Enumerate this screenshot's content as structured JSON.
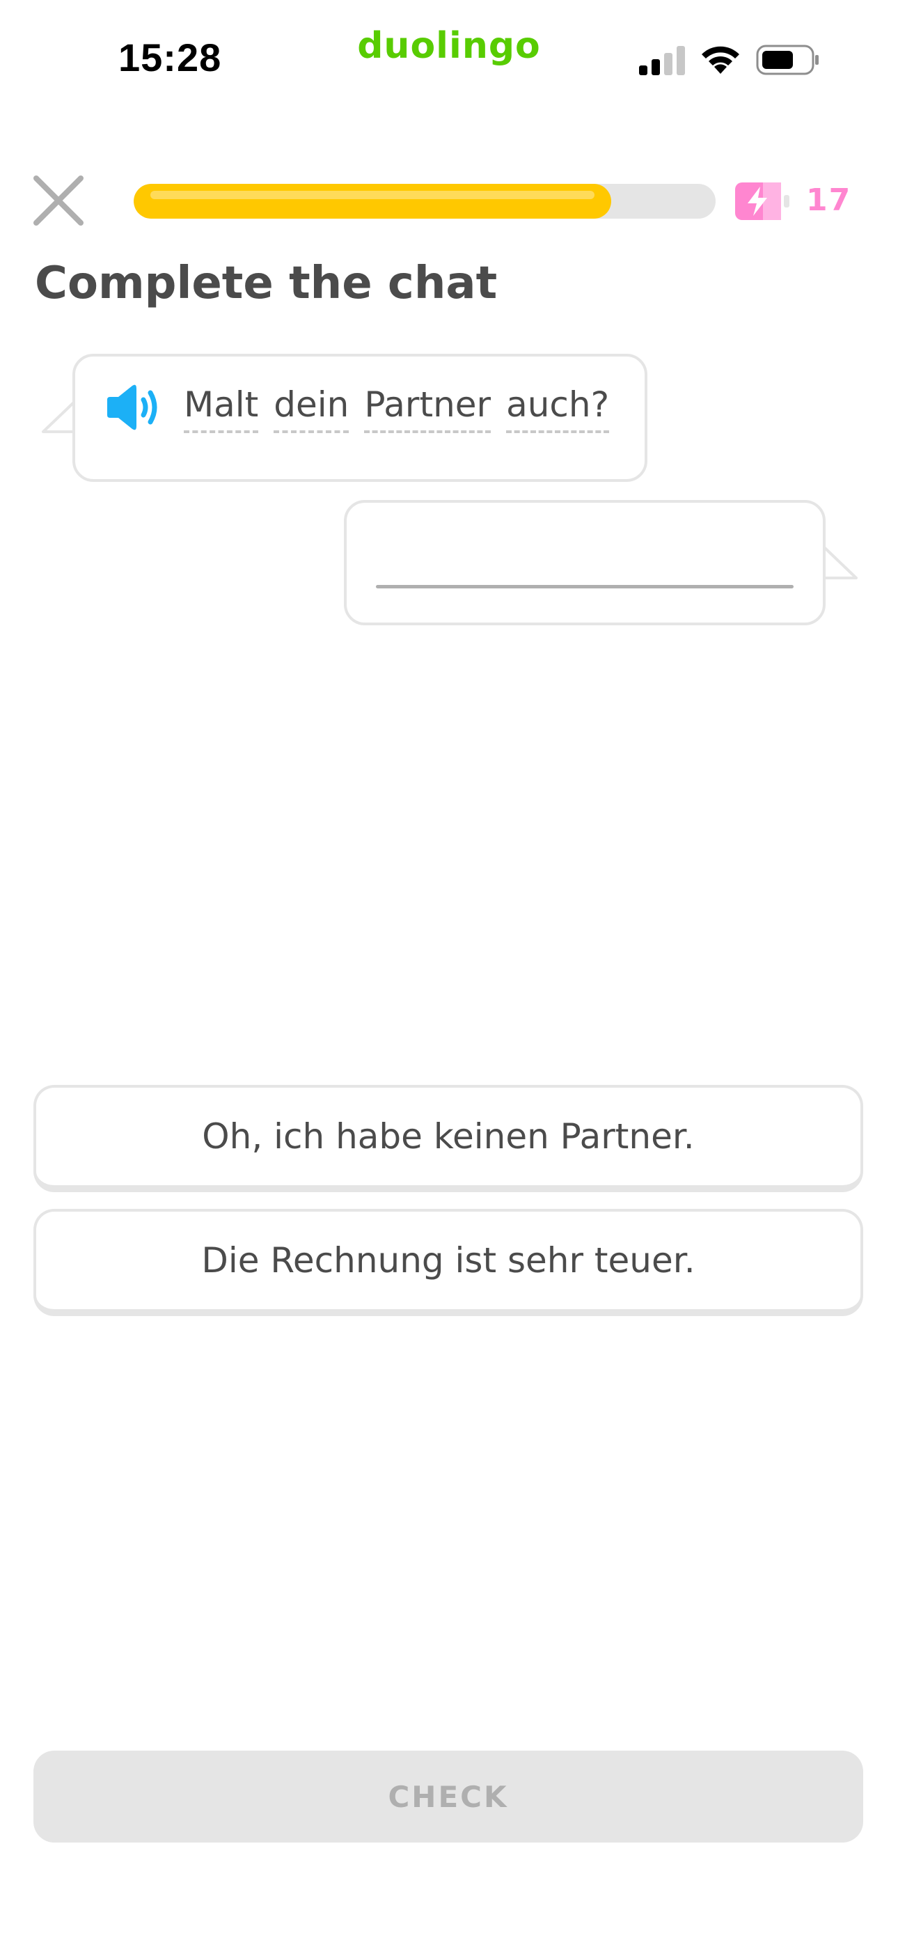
{
  "status_bar": {
    "time": "15:28",
    "app_label": "duolingo",
    "icons": [
      "signal-icon",
      "wifi-icon",
      "battery-icon"
    ]
  },
  "lesson_header": {
    "close_icon": "close-icon",
    "progress_fraction": 0.82,
    "energy_icon": "energy-icon",
    "energy_count": "17"
  },
  "title": "Complete the chat",
  "chat": {
    "speaker_icon": "speaker-icon",
    "prompt_words": [
      "Malt",
      "dein",
      "Partner",
      "auch?"
    ],
    "answer_placeholder": ""
  },
  "options": [
    {
      "label": "Oh, ich habe keinen Partner."
    },
    {
      "label": "Die Rechnung ist sehr teuer."
    }
  ],
  "check_button": {
    "label": "CHECK",
    "enabled": false
  },
  "colors": {
    "brand_green": "#58cc02",
    "progress_yellow": "#ffc800",
    "energy_pink": "#ff86d0",
    "speaker_blue": "#1cb0f6",
    "border_gray": "#e5e5e5",
    "text_dark": "#4b4b4b",
    "disabled_text": "#afafaf"
  }
}
